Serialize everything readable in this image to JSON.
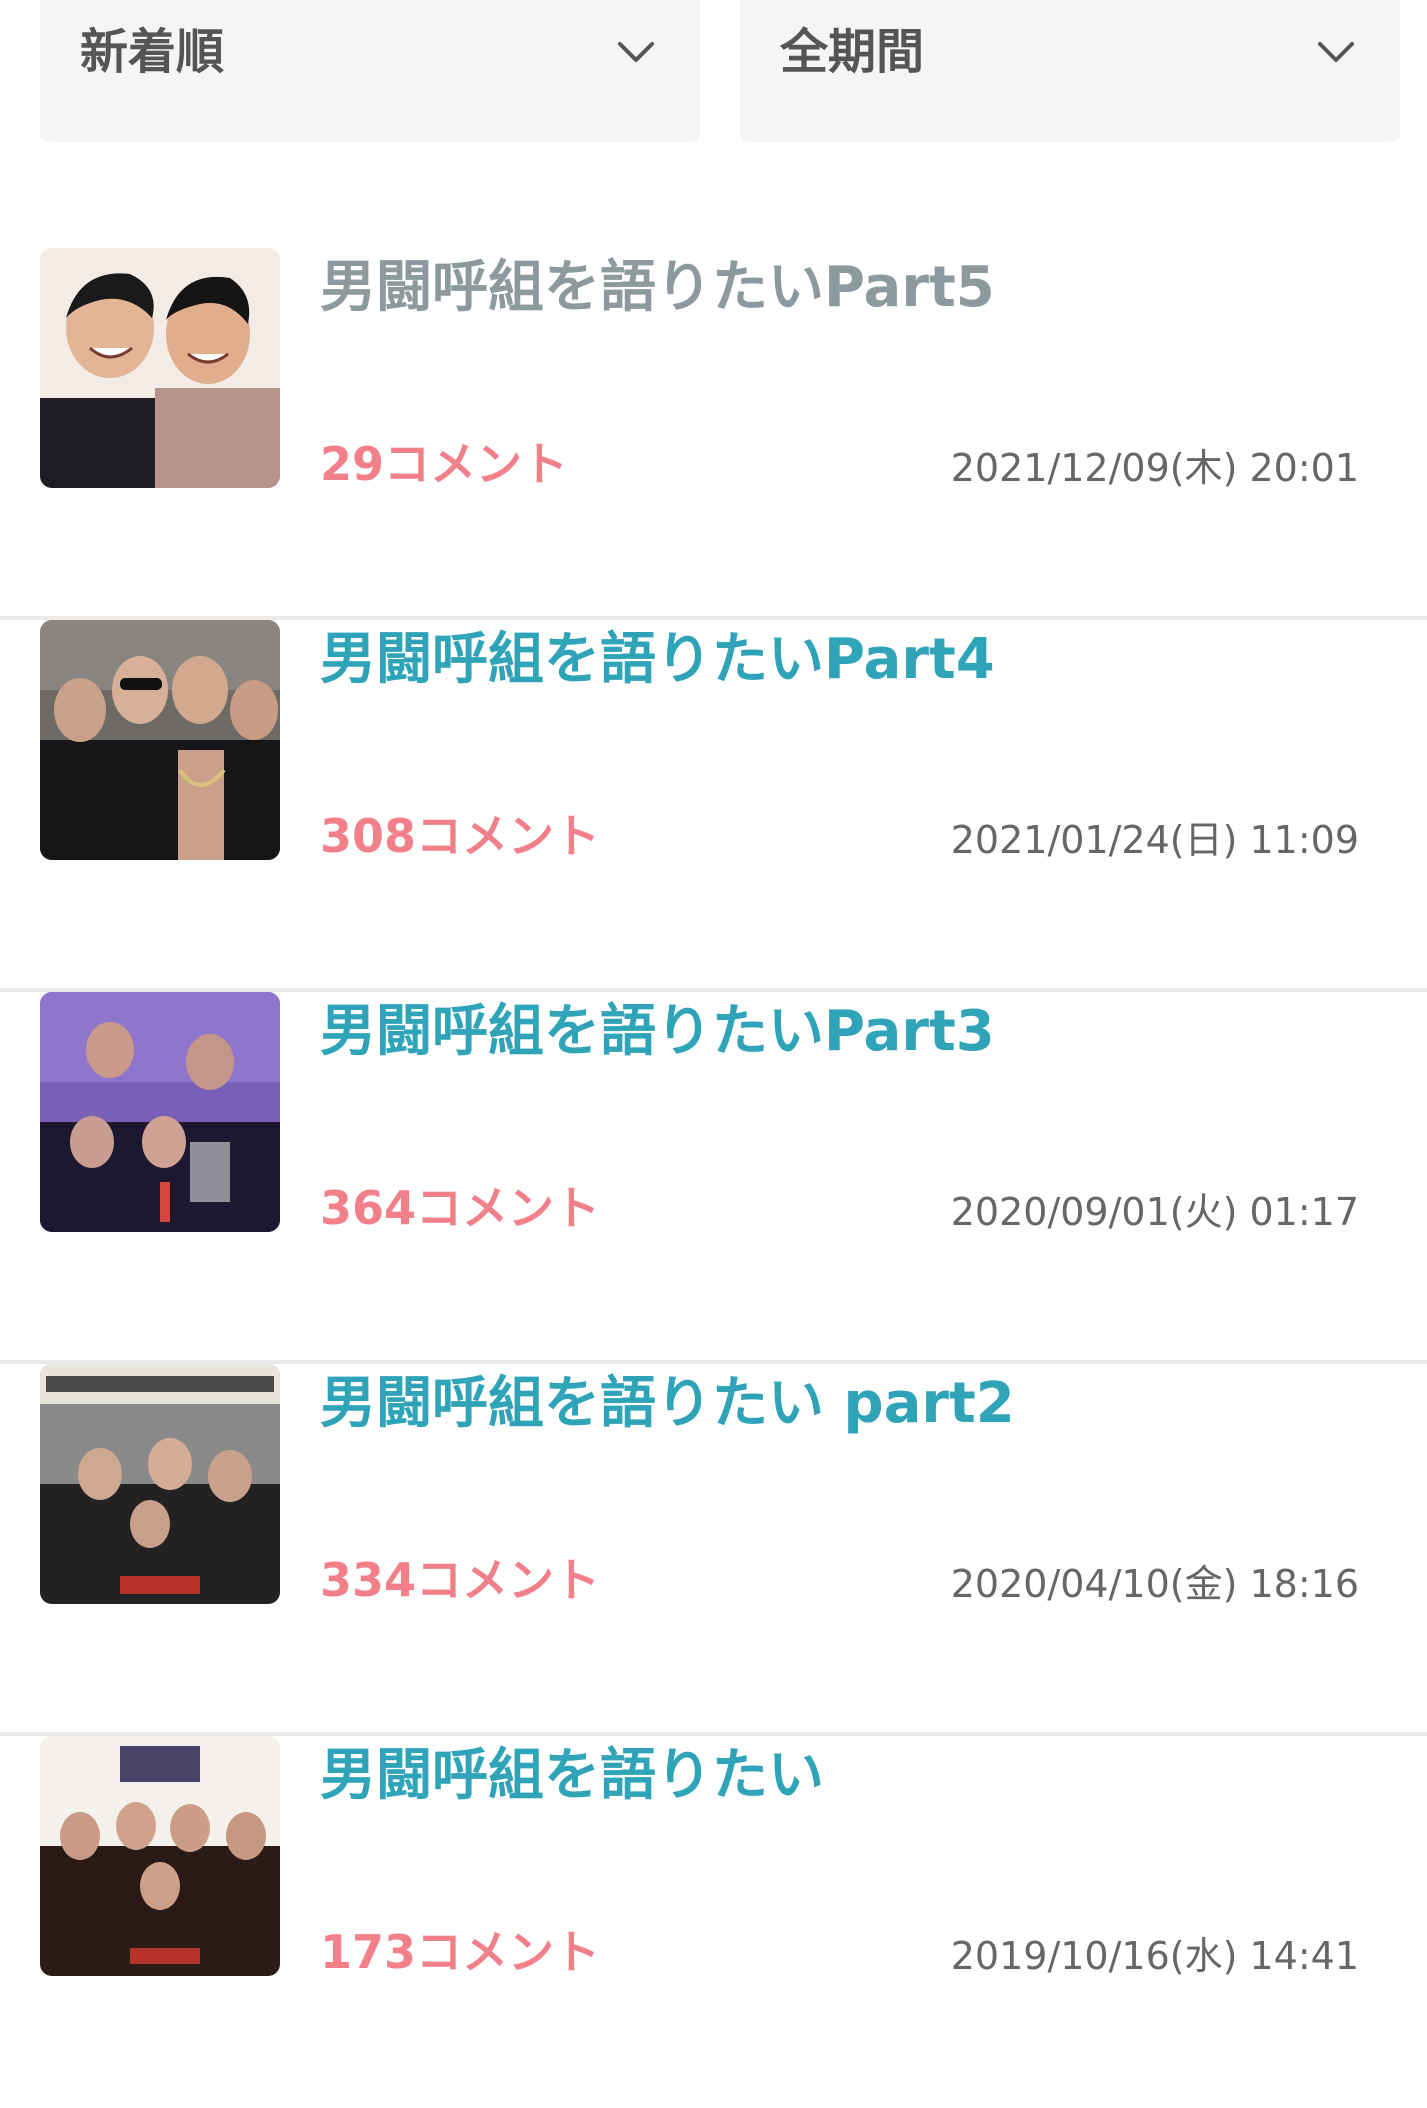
{
  "filters": {
    "sort": {
      "label": "新着順",
      "icon": "chevron-down-icon"
    },
    "period": {
      "label": "全期間",
      "icon": "chevron-down-icon"
    }
  },
  "colors": {
    "title": "#2fa3b8",
    "title_visited": "#8c9a9e",
    "comment_count": "#f2808a",
    "date": "#666666",
    "filter_bg": "#f5f5f5",
    "divider": "#ebebeb"
  },
  "threads": [
    {
      "title": "男闘呼組を語りたいPart5",
      "comments": "29コメント",
      "date": "2021/12/09(木) 20:01",
      "visited": true
    },
    {
      "title": "男闘呼組を語りたいPart4",
      "comments": "308コメント",
      "date": "2021/01/24(日) 11:09",
      "visited": false
    },
    {
      "title": "男闘呼組を語りたいPart3",
      "comments": "364コメント",
      "date": "2020/09/01(火) 01:17",
      "visited": false
    },
    {
      "title": "男闘呼組を語りたい part2",
      "comments": "334コメント",
      "date": "2020/04/10(金) 18:16",
      "visited": false
    },
    {
      "title": "男闘呼組を語りたい",
      "comments": "173コメント",
      "date": "2019/10/16(水) 14:41",
      "visited": false
    }
  ]
}
